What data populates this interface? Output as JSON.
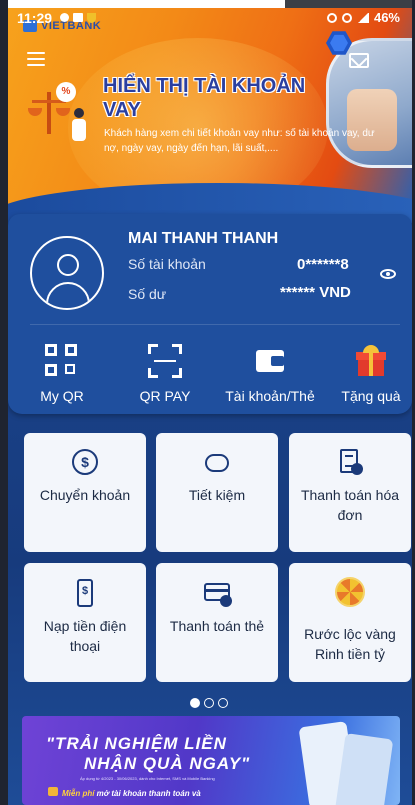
{
  "status_bar": {
    "time": "11:29",
    "battery": "46%"
  },
  "banner": {
    "brand": "VIETBANK",
    "title": "HIỂN THỊ TÀI KHOẢN VAY",
    "description": "Khách hàng xem chi tiết khoản vay như: số tài khoản vay, dư nợ, ngày vay, ngày đến hạn, lãi suất,....",
    "badge": "%"
  },
  "account": {
    "name": "MAI THANH THANH",
    "account_number_label": "Số tài khoản",
    "account_number": "0******8",
    "balance_label": "Số dư",
    "balance": "****** VND"
  },
  "quick_actions": [
    {
      "label": "My QR",
      "icon": "qr-code-icon"
    },
    {
      "label": "QR PAY",
      "icon": "scan-icon"
    },
    {
      "label": "Tài khoản/Thẻ",
      "icon": "wallet-icon"
    },
    {
      "label": "Tặng quà",
      "icon": "gift-icon"
    }
  ],
  "services": [
    {
      "label": "Chuyển khoản",
      "icon": "transfer-icon"
    },
    {
      "label": "Tiết kiệm",
      "icon": "piggy-bank-icon"
    },
    {
      "label": "Thanh toán hóa đơn",
      "icon": "bill-icon"
    },
    {
      "label": "Nạp tiền điện thoại",
      "icon": "phone-topup-icon"
    },
    {
      "label": "Thanh toán thẻ",
      "icon": "card-payment-icon"
    },
    {
      "label": "Rước lộc vàng Rinh tiền tỷ",
      "icon": "lucky-wheel-icon"
    }
  ],
  "pagination": {
    "pages": 3,
    "current": 1
  },
  "promo": {
    "line1": "\"TRẢI NGHIỆM LIỀN",
    "line2": "NHẬN QUÀ NGAY\"",
    "fine_print": "Áp dụng từ 4/2023 - 30/06/2023, dành cho Internet, SMS và Mobile Banking",
    "footer_bold": "Miễn phí",
    "footer_rest": " mở tài khoản thanh toán và"
  },
  "colors": {
    "background": "#1a4289",
    "card": "#1f4f9e",
    "tile": "#f3f6fb",
    "tile_text": "#1c2a44",
    "banner_orange": "#f38a17"
  }
}
